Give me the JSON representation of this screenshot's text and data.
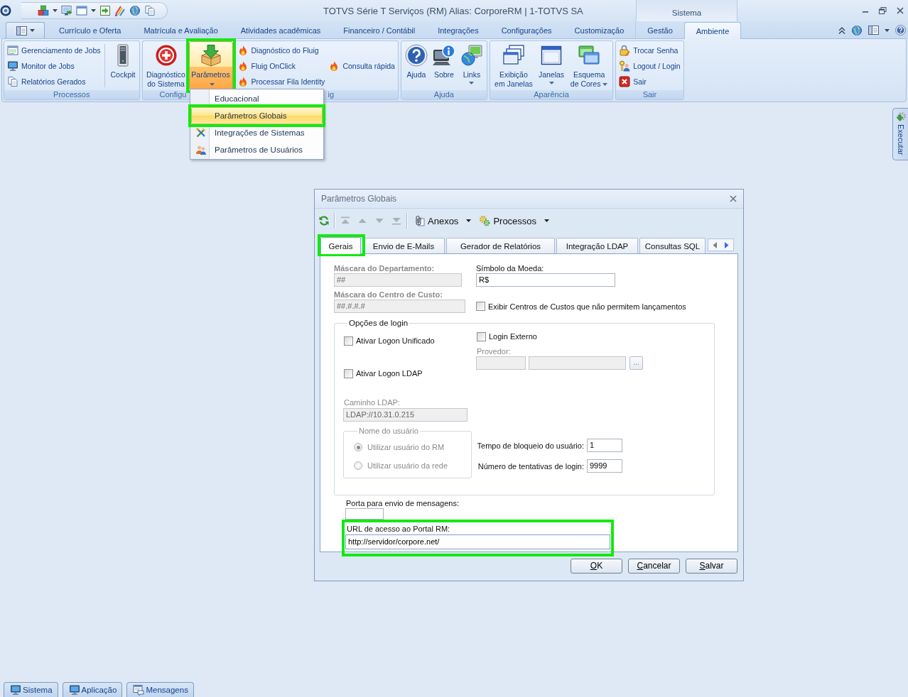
{
  "title_bar": {
    "title": "TOTVS Série T Serviços (RM) Alias: CorporeRM | 1-TOTVS SA",
    "context_tab": "Sistema"
  },
  "ribbon_tabs": [
    {
      "label": "Currículo e Oferta",
      "selected": false
    },
    {
      "label": "Matrícula e Avaliação",
      "selected": false
    },
    {
      "label": "Atividades acadêmicas",
      "selected": false
    },
    {
      "label": "Financeiro / Contábil",
      "selected": false
    },
    {
      "label": "Integrações",
      "selected": false
    },
    {
      "label": "Configurações",
      "selected": false
    },
    {
      "label": "Customização",
      "selected": false
    },
    {
      "label": "Gestão",
      "selected": false
    },
    {
      "label": "Ambiente",
      "selected": true
    }
  ],
  "ribbon_groups": [
    {
      "label": "Processos",
      "items": [
        {
          "kind": "small",
          "label": "Gerenciamento de Jobs",
          "highlighted": false
        },
        {
          "kind": "small",
          "label": "Monitor de Jobs",
          "highlighted": false
        },
        {
          "kind": "small",
          "label": "Relatórios Gerados",
          "highlighted": false
        },
        {
          "kind": "large",
          "label": "Cockpit",
          "dropdown": false,
          "expanded": false,
          "highlighted": false
        }
      ]
    },
    {
      "label": "Configu",
      "items": [
        {
          "kind": "large",
          "label": "Diagnóstico do Sistema",
          "dropdown": false,
          "expanded": false,
          "highlighted": false
        },
        {
          "kind": "large",
          "label": "Parâmetros",
          "dropdown": true,
          "expanded": true,
          "highlighted": true
        }
      ]
    },
    {
      "label": "ig",
      "items": [
        {
          "kind": "small",
          "label": "Diagnóstico do Fluig",
          "highlighted": false
        },
        {
          "kind": "small",
          "label": "Fluig OnClick",
          "highlighted": false
        },
        {
          "kind": "small",
          "label": "Processar Fila Identity",
          "highlighted": false
        },
        {
          "kind": "small",
          "label": "Consulta rápida",
          "highlighted": false
        }
      ]
    },
    {
      "label": "Ajuda",
      "items": [
        {
          "kind": "large",
          "label": "Ajuda",
          "dropdown": false,
          "expanded": false,
          "highlighted": false
        },
        {
          "kind": "large",
          "label": "Sobre",
          "dropdown": false,
          "expanded": false,
          "highlighted": false
        },
        {
          "kind": "large",
          "label": "Links",
          "dropdown": true,
          "expanded": false,
          "highlighted": false
        }
      ]
    },
    {
      "label": "Aparência",
      "items": [
        {
          "kind": "large",
          "label": "Exibição em Janelas",
          "dropdown": false,
          "expanded": false,
          "highlighted": false
        },
        {
          "kind": "large",
          "label": "Janelas",
          "dropdown": true,
          "expanded": false,
          "highlighted": false
        },
        {
          "kind": "large",
          "label": "Esquema de Cores",
          "dropdown": true,
          "expanded": false,
          "highlighted": false
        }
      ]
    },
    {
      "label": "Sair",
      "items": [
        {
          "kind": "small",
          "label": "Trocar Senha",
          "highlighted": false
        },
        {
          "kind": "small",
          "label": "Logout / Login",
          "highlighted": false
        },
        {
          "kind": "small",
          "label": "Sair",
          "highlighted": false
        }
      ]
    }
  ],
  "parameters_menu": {
    "items": [
      {
        "label": "Educacional",
        "selected": false,
        "highlighted": false
      },
      {
        "label": "Parâmetros Globais",
        "selected": true,
        "highlighted": true
      },
      {
        "label": "Integrações de Sistemas",
        "selected": false,
        "highlighted": false
      },
      {
        "label": "Parâmetros de Usuários",
        "selected": false,
        "highlighted": false
      }
    ]
  },
  "side_panel": {
    "label": "Executar"
  },
  "dialog": {
    "title": "Parâmetros Globais",
    "toolbar": {
      "navigation_disabled": true,
      "menus": [
        {
          "label": "Anexos"
        },
        {
          "label": "Processos"
        }
      ]
    },
    "tabs": [
      {
        "label": "Gerais",
        "selected": true,
        "highlighted": true
      },
      {
        "label": "Envio de E-Mails",
        "selected": false,
        "highlighted": false
      },
      {
        "label": "Gerador de Relatórios",
        "selected": false,
        "highlighted": false
      },
      {
        "label": "Integração LDAP",
        "selected": false,
        "highlighted": false
      },
      {
        "label": "Consultas SQL",
        "selected": false,
        "highlighted": false
      }
    ],
    "form": {
      "department_mask": {
        "label": "Máscara do Departamento:",
        "value": "##",
        "disabled": true
      },
      "currency_symbol": {
        "label": "Símbolo da Moeda:",
        "value": "R$",
        "disabled": false
      },
      "cost_center_mask": {
        "label": "Máscara do Centro de Custo:",
        "value": "##.#.#.#",
        "disabled": true
      },
      "show_blocked_cost_centers": {
        "label": "Exibir Centros de Custos que não permitem lançamentos",
        "checked": false
      },
      "login_options": {
        "title": "Opções de login",
        "unified_logon": {
          "label": "Ativar Logon Unificado",
          "checked": false
        },
        "ldap_logon": {
          "label": "Ativar Logon LDAP",
          "checked": false
        },
        "ldap_path": {
          "label": "Caminho LDAP:",
          "value": "LDAP://10.31.0.215",
          "disabled": true
        },
        "user_name": {
          "title": "Nome do usuário",
          "disabled": true,
          "options": [
            {
              "label": "Utilizar usuário do RM",
              "selected": true
            },
            {
              "label": "Utilizar usuário da rede",
              "selected": false
            }
          ]
        },
        "external_login": {
          "label": "Login Externo",
          "checked": false
        },
        "provider": {
          "label": "Provedor:",
          "disabled": true,
          "browse_button": "..."
        },
        "lock_time": {
          "label": "Tempo de bloqueio do usuário:",
          "value": "1"
        },
        "login_attempts": {
          "label": "Número de tentativas de login:",
          "value": "9999"
        }
      },
      "message_port": {
        "label": "Porta para envio de mensagens:"
      },
      "portal_url": {
        "label": "URL de acesso ao Portal RM:",
        "value": "http://servidor/corpore.net/",
        "focused": true,
        "highlighted": true
      }
    },
    "buttons": [
      {
        "label": "OK"
      },
      {
        "label": "Cancelar"
      },
      {
        "label": "Salvar"
      }
    ]
  },
  "taskbar": [
    {
      "label": "Sistema"
    },
    {
      "label": "Aplicação"
    },
    {
      "label": "Mensagens"
    }
  ]
}
